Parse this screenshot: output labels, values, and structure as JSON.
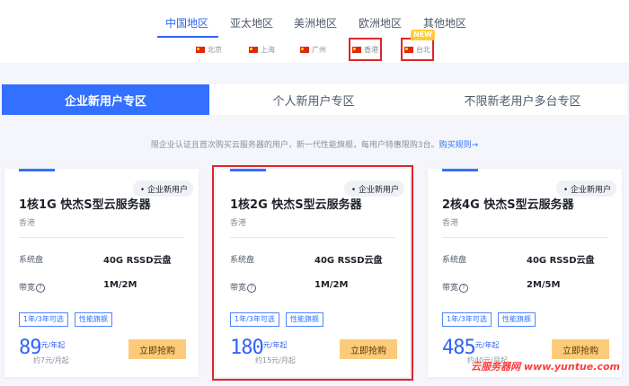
{
  "region_tabs": [
    "中国地区",
    "亚太地区",
    "美洲地区",
    "欧洲地区",
    "其他地区"
  ],
  "cities": [
    "北京",
    "上海",
    "广州",
    "香港",
    "台北"
  ],
  "new_badge": "NEW",
  "user_tabs": [
    "企业新用户专区",
    "个人新用户专区",
    "不限新老用户多台专区"
  ],
  "notice": {
    "text": "限企业认证且首次购买云服务器的用户，新一代性能旗舰，每用户特惠限购3台。",
    "link": "购买规则→"
  },
  "cards": [
    {
      "badge": "• 企业新用户",
      "title": "1核1G 快杰S型云服务器",
      "region": "香港",
      "disk_label": "系统盘",
      "disk_value": "40G RSSD云盘",
      "bw_label": "带宽",
      "bw_value": "1M/2M",
      "tags": [
        "1年/3年可选",
        "性能旗舰"
      ],
      "price": "89",
      "unit": "元/年起",
      "monthly": "约7元/月起",
      "buy": "立即抢购"
    },
    {
      "badge": "• 企业新用户",
      "title": "1核2G 快杰S型云服务器",
      "region": "香港",
      "disk_label": "系统盘",
      "disk_value": "40G RSSD云盘",
      "bw_label": "带宽",
      "bw_value": "1M/2M",
      "tags": [
        "1年/3年可选",
        "性能旗舰"
      ],
      "price": "180",
      "unit": "元/年起",
      "monthly": "约15元/月起",
      "buy": "立即抢购"
    },
    {
      "badge": "• 企业新用户",
      "title": "2核4G 快杰S型云服务器",
      "region": "香港",
      "disk_label": "系统盘",
      "disk_value": "40G RSSD云盘",
      "bw_label": "带宽",
      "bw_value": "2M/5M",
      "tags": [
        "1年/3年可选",
        "性能旗舰"
      ],
      "price": "485",
      "unit": "元/年起",
      "monthly": "约40元/月起",
      "buy": "立即抢购"
    }
  ],
  "watermark": "云服务器网 www.yuntue.com",
  "colors": {
    "accent": "#3370ff",
    "highlight_box": "#e0242b",
    "buy_button": "#fccb7a"
  }
}
